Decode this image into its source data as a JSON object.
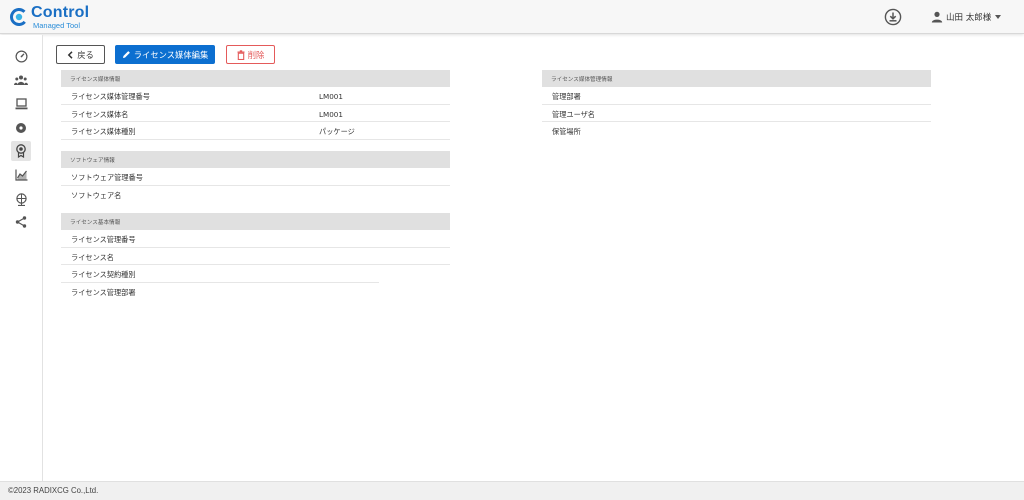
{
  "header": {
    "logo_main": "Control",
    "logo_sub": "Managed Tool",
    "user_name": "山田 太郎様"
  },
  "toolbar": {
    "back_label": "戻る",
    "edit_label": "ライセンス媒体編集",
    "delete_label": "削除"
  },
  "media_info": {
    "title": "ライセンス媒体情報",
    "rows": [
      {
        "label": "ライセンス媒体管理番号",
        "value": "LM001"
      },
      {
        "label": "ライセンス媒体名",
        "value": "LM001"
      },
      {
        "label": "ライセンス媒体種別",
        "value": "パッケージ"
      }
    ]
  },
  "software_info": {
    "title": "ソフトウェア情報",
    "rows": [
      {
        "label": "ソフトウェア管理番号",
        "value": ""
      },
      {
        "label": "ソフトウェア名",
        "value": ""
      }
    ]
  },
  "license_info": {
    "title": "ライセンス基本情報",
    "rows": [
      {
        "label": "ライセンス管理番号",
        "value": ""
      },
      {
        "label": "ライセンス名",
        "value": ""
      },
      {
        "label": "ライセンス契約種別",
        "value": ""
      },
      {
        "label": "ライセンス管理部署",
        "value": ""
      }
    ]
  },
  "media_mgmt_info": {
    "title": "ライセンス媒体管理情報",
    "rows": [
      {
        "label": "管理部署",
        "value": ""
      },
      {
        "label": "管理ユーザ名",
        "value": ""
      },
      {
        "label": "保管場所",
        "value": ""
      }
    ]
  },
  "sidebar": {
    "items": [
      {
        "icon": "speedometer-icon"
      },
      {
        "icon": "users-icon"
      },
      {
        "icon": "computer-icon"
      },
      {
        "icon": "disc-icon"
      },
      {
        "icon": "license-badge-icon",
        "active": true
      },
      {
        "icon": "chart-icon"
      },
      {
        "icon": "network-globe-icon"
      },
      {
        "icon": "share-icon"
      }
    ]
  },
  "footer": {
    "copyright": "©2023 RADIXCG Co.,Ltd."
  },
  "colors": {
    "primary": "#0c6fd0",
    "danger": "#e45a5a",
    "logo": "#1a6fc4",
    "section_header": "#e0e0e0"
  }
}
